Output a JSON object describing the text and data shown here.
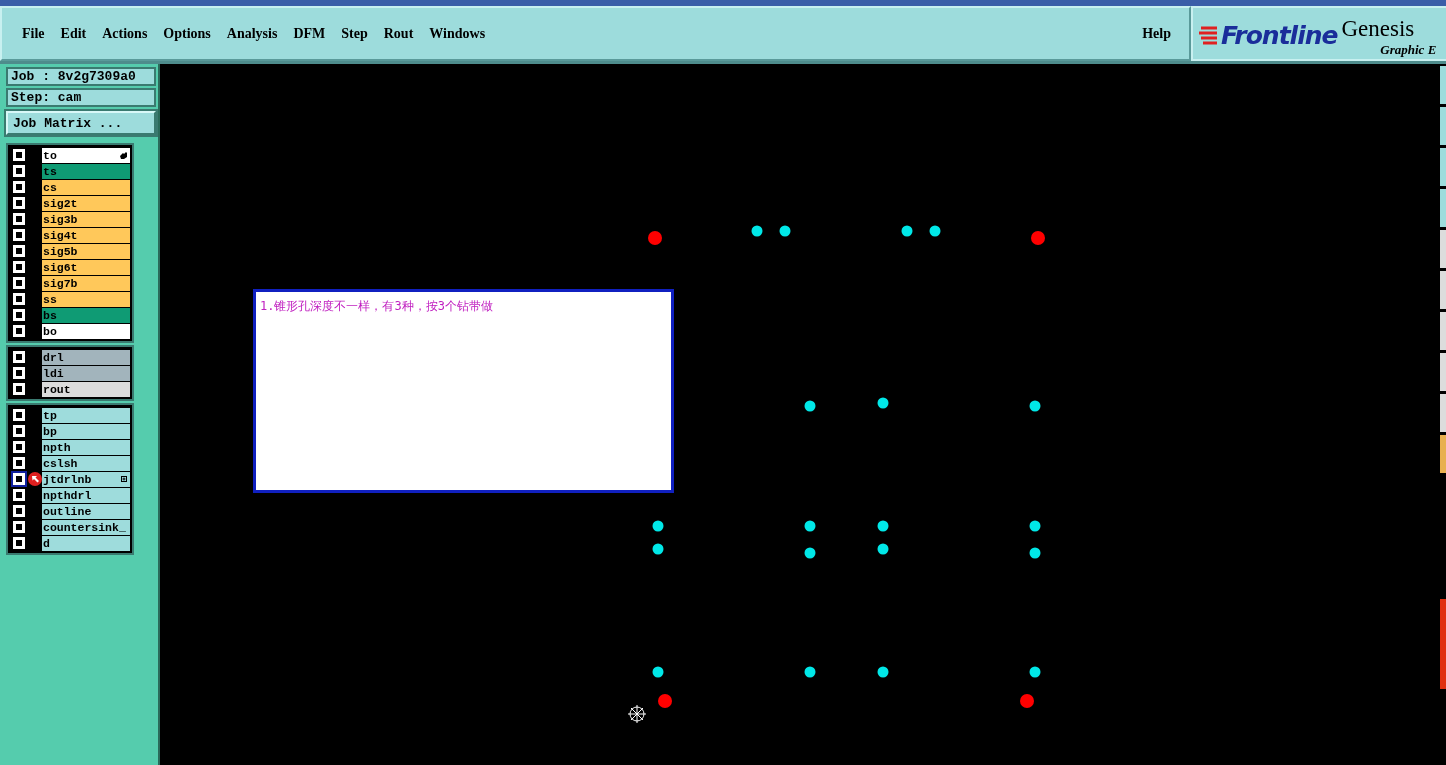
{
  "menu": [
    "File",
    "Edit",
    "Actions",
    "Options",
    "Analysis",
    "DFM",
    "Step",
    "Rout",
    "Windows"
  ],
  "help": "Help",
  "brand": {
    "logo": "Frontline",
    "product": "Genesis",
    "subtitle": "Graphic E"
  },
  "job": {
    "job": "Job : 8v2g7309a0",
    "step": "Step: cam",
    "matrix_button": "Job Matrix ..."
  },
  "layer_groups": [
    [
      {
        "name": "to",
        "color": "#ffffff",
        "checked": false,
        "selected": false,
        "work": false,
        "hand": true,
        "tool": false
      },
      {
        "name": "ts",
        "color": "#0f9b74",
        "checked": false,
        "selected": false,
        "work": false,
        "hand": false,
        "tool": false
      },
      {
        "name": "cs",
        "color": "#ffc85a",
        "checked": false,
        "selected": false,
        "work": false,
        "hand": false,
        "tool": false
      },
      {
        "name": "sig2t",
        "color": "#ffc85a",
        "checked": false,
        "selected": false,
        "work": false,
        "hand": false,
        "tool": false
      },
      {
        "name": "sig3b",
        "color": "#ffc85a",
        "checked": false,
        "selected": false,
        "work": false,
        "hand": false,
        "tool": false
      },
      {
        "name": "sig4t",
        "color": "#ffc85a",
        "checked": false,
        "selected": false,
        "work": false,
        "hand": false,
        "tool": false
      },
      {
        "name": "sig5b",
        "color": "#ffc85a",
        "checked": false,
        "selected": false,
        "work": false,
        "hand": false,
        "tool": false
      },
      {
        "name": "sig6t",
        "color": "#ffc85a",
        "checked": false,
        "selected": false,
        "work": false,
        "hand": false,
        "tool": false
      },
      {
        "name": "sig7b",
        "color": "#ffc85a",
        "checked": false,
        "selected": false,
        "work": false,
        "hand": false,
        "tool": false
      },
      {
        "name": "ss",
        "color": "#ffc85a",
        "checked": false,
        "selected": false,
        "work": false,
        "hand": false,
        "tool": false
      },
      {
        "name": "bs",
        "color": "#0f9b74",
        "checked": false,
        "selected": false,
        "work": false,
        "hand": false,
        "tool": false
      },
      {
        "name": "bo",
        "color": "#ffffff",
        "checked": false,
        "selected": false,
        "work": false,
        "hand": false,
        "tool": false
      }
    ],
    [
      {
        "name": "drl",
        "color": "#a2b4bc",
        "checked": false,
        "selected": false,
        "work": false,
        "hand": false,
        "tool": false
      },
      {
        "name": "ldi",
        "color": "#a2b4bc",
        "checked": false,
        "selected": false,
        "work": false,
        "hand": false,
        "tool": false
      },
      {
        "name": "rout",
        "color": "#dcdcdc",
        "checked": false,
        "selected": false,
        "work": false,
        "hand": false,
        "tool": false
      }
    ],
    [
      {
        "name": "tp",
        "color": "#9edcdc",
        "checked": false,
        "selected": false,
        "work": false,
        "hand": false,
        "tool": false
      },
      {
        "name": "bp",
        "color": "#9edcdc",
        "checked": false,
        "selected": false,
        "work": false,
        "hand": false,
        "tool": false
      },
      {
        "name": "npth",
        "color": "#9edcdc",
        "checked": false,
        "selected": false,
        "work": false,
        "hand": false,
        "tool": false
      },
      {
        "name": "cslsh",
        "color": "#9edcdc",
        "checked": false,
        "selected": false,
        "work": false,
        "hand": false,
        "tool": false
      },
      {
        "name": "jtdrlnb",
        "color": "#9edcdc",
        "checked": false,
        "selected": true,
        "work": true,
        "hand": false,
        "tool": true
      },
      {
        "name": "npthdrl",
        "color": "#9edcdc",
        "checked": false,
        "selected": false,
        "work": false,
        "hand": false,
        "tool": false
      },
      {
        "name": "outline",
        "color": "#9edcdc",
        "checked": false,
        "selected": false,
        "work": false,
        "hand": false,
        "tool": false
      },
      {
        "name": "countersink_",
        "color": "#9edcdc",
        "checked": false,
        "selected": false,
        "work": false,
        "hand": false,
        "tool": false
      },
      {
        "name": "d",
        "color": "#9edcdc",
        "checked": false,
        "selected": false,
        "work": false,
        "hand": false,
        "tool": false
      }
    ]
  ],
  "note": "1.锥形孔深度不一样，有3种，按3个钻带做"
}
